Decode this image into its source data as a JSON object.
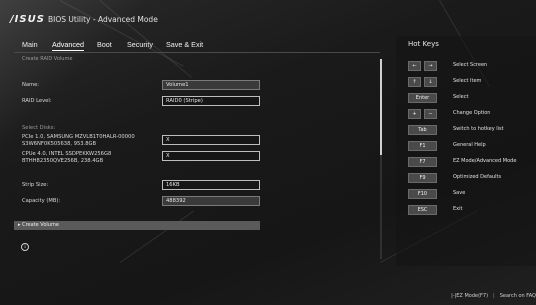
{
  "header": {
    "logo_text": "/ISUS",
    "title": "BIOS Utility - Advanced Mode"
  },
  "menu": {
    "items": [
      {
        "label": "Main"
      },
      {
        "label": "Advanced"
      },
      {
        "label": "Boot"
      },
      {
        "label": "Security"
      },
      {
        "label": "Save & Exit"
      }
    ],
    "active_item": "Advanced"
  },
  "main": {
    "section_title": "Create RAID Volume",
    "name_label": "Name:",
    "name_value": "Volume1",
    "raid_level_label": "RAID Level:",
    "raid_level_value": "RAID0 (Stripe)",
    "select_disks_label": "Select Disks:",
    "disks": [
      {
        "line1": "PCIe 1.0, SAMSUNG MZVLB1T0HALR-00000",
        "line2": "S3W6NF0K505638, 953.8GB",
        "value": "X"
      },
      {
        "line1": "CPUe 4.0, INTEL SSDPEKKW256G8",
        "line2": "BTHH82350QVE256B, 238.4GB",
        "value": "X"
      }
    ],
    "strip_size_label": "Strip Size:",
    "strip_size_value": "16KB",
    "capacity_label": "Capacity (MB):",
    "capacity_value": "488392",
    "create_volume_label": "▸ Create Volume"
  },
  "hotkeys": {
    "title": "Hot Keys",
    "items": [
      {
        "keys": [
          "←",
          "→"
        ],
        "desc": "Select Screen"
      },
      {
        "keys": [
          "↑",
          "↓"
        ],
        "desc": "Select Item"
      },
      {
        "keys": [
          "Enter"
        ],
        "desc": "Select"
      },
      {
        "keys": [
          "+",
          "−"
        ],
        "desc": "Change Option"
      },
      {
        "keys": [
          "Tab"
        ],
        "desc": "Switch to hotkey list"
      },
      {
        "keys": [
          "F1"
        ],
        "desc": "General Help"
      },
      {
        "keys": [
          "F7"
        ],
        "desc": "EZ Mode/Advanced Mode"
      },
      {
        "keys": [
          "F9"
        ],
        "desc": "Optimized Defaults"
      },
      {
        "keys": [
          "F10"
        ],
        "desc": "Save"
      },
      {
        "keys": [
          "ESC"
        ],
        "desc": "Exit"
      }
    ]
  },
  "footer": {
    "ez_mode": "|-|EZ Mode(F7)",
    "search_faq": "Search on FAQ"
  },
  "colors": {
    "background": "#1b1b1b",
    "text": "#e6e6e6",
    "create_bar": "#5a5a5a"
  }
}
